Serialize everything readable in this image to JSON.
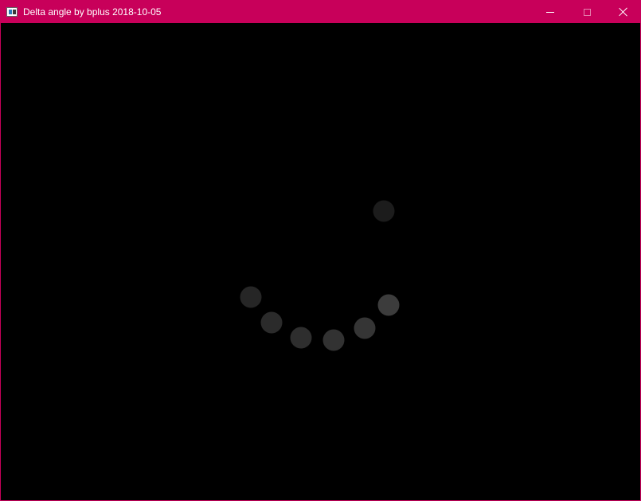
{
  "window": {
    "title": "Delta angle by bplus 2018-10-05",
    "accent_color": "#c8005a",
    "icon": "app-window-icon"
  },
  "controls": {
    "minimize_icon": "minimize-icon",
    "maximize_icon": "maximize-icon",
    "close_icon": "close-icon"
  },
  "canvas": {
    "background": "#000000",
    "dots": [
      {
        "color": "#1c1c1c"
      },
      {
        "color": "#3c3c3c"
      },
      {
        "color": "#353535"
      },
      {
        "color": "#323232"
      },
      {
        "color": "#2e2e2e"
      },
      {
        "color": "#2b2b2b"
      },
      {
        "color": "#262626"
      }
    ]
  }
}
